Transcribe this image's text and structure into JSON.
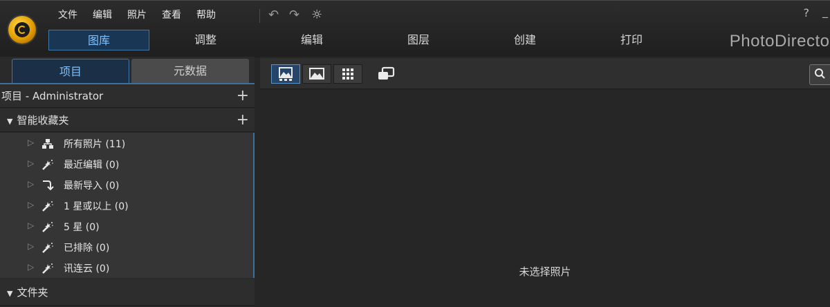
{
  "menu": [
    "文件",
    "编辑",
    "照片",
    "查看",
    "帮助"
  ],
  "modes": [
    {
      "label": "图库",
      "active": true
    },
    {
      "label": "调整"
    },
    {
      "label": "编辑"
    },
    {
      "label": "图层"
    },
    {
      "label": "创建"
    },
    {
      "label": "打印"
    }
  ],
  "brand": "PhotoDirector",
  "window": {
    "help": "?",
    "minimize": "_"
  },
  "left": {
    "tabs": [
      "项目",
      "元数据"
    ],
    "project_header": "项目 - Administrator",
    "smart_header": "智能收藏夹",
    "items": [
      {
        "label": "所有照片 (11)",
        "icon": "hierarchy-icon"
      },
      {
        "label": "最近编辑 (0)",
        "icon": "magic-wand-icon"
      },
      {
        "label": "最新导入 (0)",
        "icon": "import-arrow-icon"
      },
      {
        "label": "1 星或以上 (0)",
        "icon": "magic-wand-icon"
      },
      {
        "label": "5 星 (0)",
        "icon": "magic-wand-icon"
      },
      {
        "label": "已排除 (0)",
        "icon": "magic-wand-icon"
      },
      {
        "label": "讯连云 (0)",
        "icon": "magic-wand-icon"
      }
    ],
    "folder_header": "文件夹"
  },
  "main": {
    "empty_text": "未选择照片"
  },
  "colors": {
    "accent": "#7fc2ff",
    "accent_border": "#3f77a8",
    "bg": "#262626"
  }
}
